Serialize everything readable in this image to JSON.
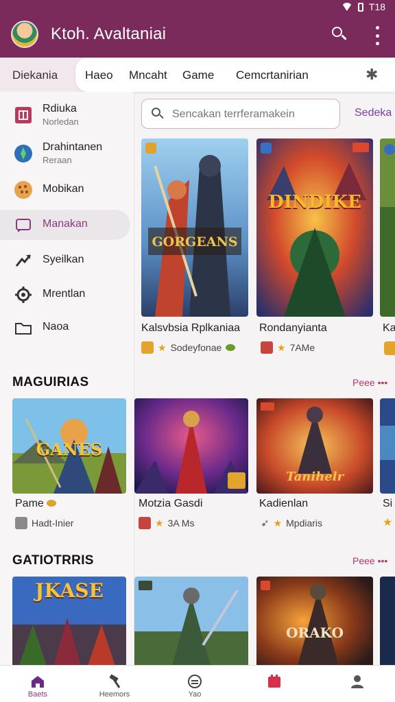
{
  "status": {
    "time": "T18"
  },
  "app": {
    "title": "Ktoh. Avaltaniai"
  },
  "tabs": {
    "first": "Diekania",
    "items": [
      "Haeo",
      "Mncaht",
      "Game",
      "Cemcrtanirian"
    ]
  },
  "sidebar": {
    "items": [
      {
        "label": "Rdiuka",
        "sub": "Norledan",
        "icon": "grid-icon"
      },
      {
        "label": "Drahintanen",
        "sub": "Reraan",
        "icon": "compass-icon"
      },
      {
        "label": "Mobikan",
        "icon": "cookie-icon"
      },
      {
        "label": "Manakan",
        "icon": "chat-icon",
        "active": true
      },
      {
        "label": "Syeilkan",
        "icon": "trending-icon"
      },
      {
        "label": "Mrentlan",
        "icon": "gear-icon"
      },
      {
        "label": "Naoa",
        "icon": "folder-icon"
      }
    ]
  },
  "search": {
    "placeholder": "Sencakan terrferamakein"
  },
  "sort": {
    "label": "Sedeka"
  },
  "featured": [
    {
      "title": "Kalsvbsia Rplkaniaa",
      "meta": "Sodeyfonae",
      "art_text": "GORGEANS"
    },
    {
      "title": "Rondanyianta",
      "meta": "7AMe",
      "art_text": "DINDIKE"
    },
    {
      "title": "Ka",
      "meta": ""
    }
  ],
  "sections": [
    {
      "title": "MAGUIRIAS",
      "link": "Peee •••",
      "cards": [
        {
          "title": "Pame",
          "meta": "Hadt-Inier",
          "art_text": "GANES"
        },
        {
          "title": "Motzia Gasdi",
          "meta": "3A Ms",
          "art_text": ""
        },
        {
          "title": "Kadienlan",
          "meta": "Mpdiaris",
          "art_text": "Tanihelr"
        },
        {
          "title": "Si",
          "meta": ""
        }
      ]
    },
    {
      "title": "GATIOTRRIS",
      "link": "Peee •••",
      "cards": [
        {
          "title": "",
          "meta": "",
          "art_text": "JKASE"
        },
        {
          "title": "",
          "meta": "",
          "art_text": ""
        },
        {
          "title": "",
          "meta": "",
          "art_text": "ORAKO"
        }
      ]
    }
  ],
  "bottom_nav": [
    {
      "label": "Baets",
      "icon": "home-icon",
      "active": true
    },
    {
      "label": "Heemors",
      "icon": "hammer-icon"
    },
    {
      "label": "Yao",
      "icon": "smile-icon"
    },
    {
      "label": "",
      "icon": "calendar-icon"
    },
    {
      "label": "",
      "icon": "person-icon"
    }
  ],
  "colors": {
    "brand": "#7b2a5c",
    "accent": "#8b3a79",
    "link": "#b0386a"
  }
}
